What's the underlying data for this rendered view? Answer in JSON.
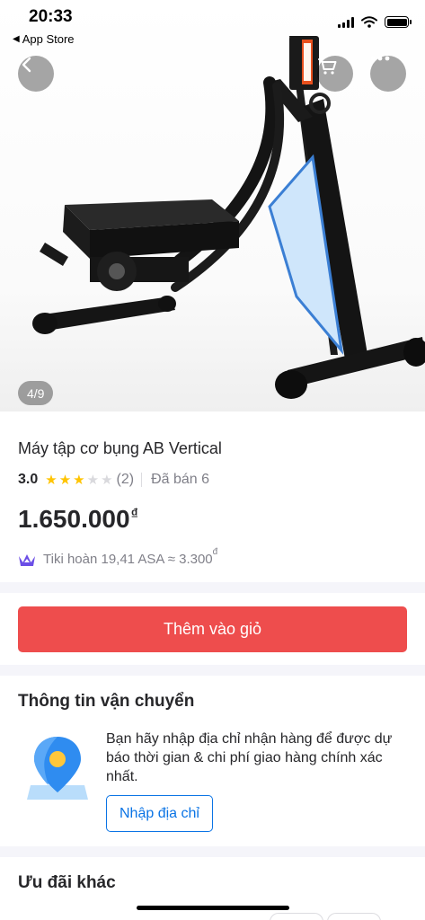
{
  "status_bar": {
    "time": "20:33",
    "back_app": "App Store"
  },
  "gallery": {
    "counter": "4/9",
    "back_icon": "chevron-left-icon",
    "cart_icon": "cart-icon",
    "more_icon": "more-dots-icon"
  },
  "product": {
    "title": "Máy tập cơ bụng AB Vertical",
    "rating": "3.0",
    "stars_filled": 3,
    "stars_total": 5,
    "review_count": "(2)",
    "sold": "Đã bán 6",
    "price": "1.650.000",
    "currency": "₫",
    "cashback_text": "Tiki hoàn 19,41 ASA ≈ 3.300",
    "cashback_currency": "đ"
  },
  "actions": {
    "add_to_cart": "Thêm vào giỏ"
  },
  "shipping": {
    "title": "Thông tin vận chuyển",
    "description": "Bạn hãy nhập địa chỉ nhận hàng để được dự báo thời gian & chi phí giao hàng chính xác nhất.",
    "enter_address": "Nhập địa chỉ"
  },
  "offers": {
    "title": "Ưu đãi khác"
  },
  "colors": {
    "accent_red": "#ee4d4d",
    "link_blue": "#0b74e5",
    "star": "#ffc400",
    "asa_purple": "#6b4ee6"
  }
}
